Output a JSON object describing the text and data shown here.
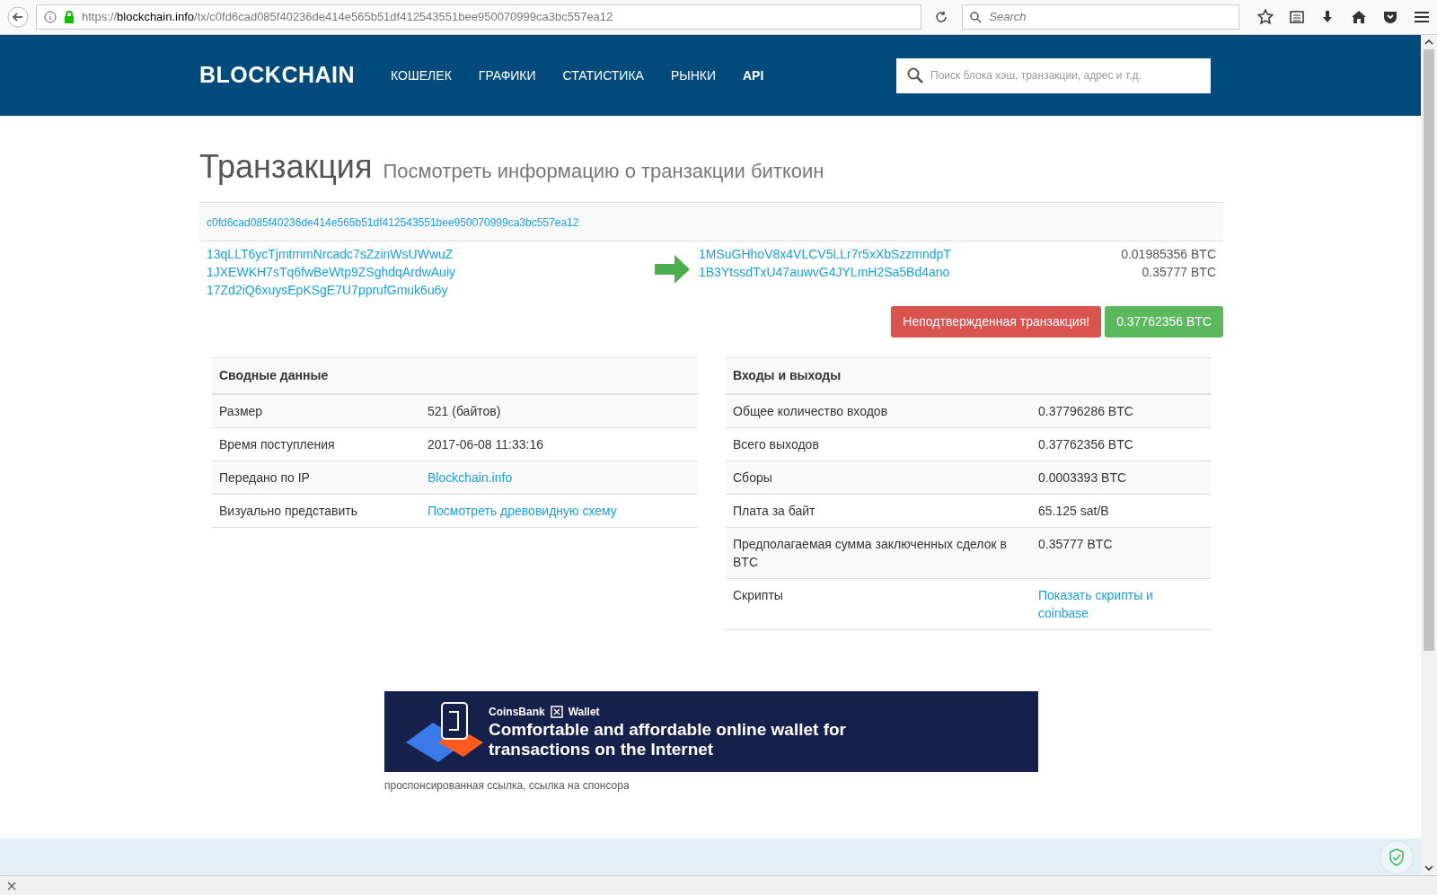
{
  "browser": {
    "url_scheme": "https://",
    "url_host": "blockchain.info",
    "url_path": "/tx/c0fd6cad085f40236de414e565b51df412543551bee950070999ca3bc557ea12",
    "search_placeholder": "Search"
  },
  "header": {
    "logo": "BLOCKCHAIN",
    "nav": [
      {
        "label": "КОШЕЛЕК",
        "bold": false
      },
      {
        "label": "ГРАФИКИ",
        "bold": false
      },
      {
        "label": "СТАТИСТИКА",
        "bold": false
      },
      {
        "label": "РЫНКИ",
        "bold": false
      },
      {
        "label": "API",
        "bold": true
      }
    ],
    "search_placeholder": "Поиск блока хэш, транзакции, адрес и т.д."
  },
  "title": "Транзакция",
  "subtitle": "Посмотреть информацию о транзакции биткоин",
  "tx_hash": "c0fd6cad085f40236de414e565b51df412543551bee950070999ca3bc557ea12",
  "inputs": [
    "13qLLT6ycTjmtmmNrcadc7sZzinWsUWwuZ",
    "1JXEWKH7sTq6fwBeWtp9ZSghdqArdwAuiy",
    "17Zd2iQ6xuysEpKSgE7U7pprufGmuk6u6y"
  ],
  "outputs": [
    {
      "address": "1MSuGHhoV8x4VLCV5LLr7r5xXbSzzmndpT",
      "amount": "0.01985356 BTC"
    },
    {
      "address": "1B3YtssdTxU47auwvG4JYLmH2Sa5Bd4ano",
      "amount": "0.35777 BTC"
    }
  ],
  "status_badge": "Неподтвержденная транзакция!",
  "total_badge": "0.37762356 BTC",
  "summary": {
    "heading": "Сводные данные",
    "rows": [
      {
        "label": "Размер",
        "value": "521 (байтов)",
        "kind": "text"
      },
      {
        "label": "Время поступления",
        "value": "2017-06-08 11:33:16",
        "kind": "text"
      },
      {
        "label": "Передано по IP",
        "value": "Blockchain.info",
        "kind": "link"
      },
      {
        "label": "Визуально представить",
        "value": "Посмотреть древовидную схему",
        "kind": "link"
      }
    ]
  },
  "inputs_outputs": {
    "heading": "Входы и выходы",
    "rows": [
      {
        "label": "Общее количество входов",
        "value": "0.37796286 BTC",
        "kind": "text"
      },
      {
        "label": "Всего выходов",
        "value": "0.37762356 BTC",
        "kind": "text"
      },
      {
        "label": "Сборы",
        "value": "0.0003393 BTC",
        "kind": "text"
      },
      {
        "label": "Плата за байт",
        "value": "65.125 sat/B",
        "kind": "text"
      },
      {
        "label": "Предполагаемая сумма заключенных сделок в BTC",
        "value": "0.35777 BTC",
        "kind": "text"
      },
      {
        "label": "Скрипты",
        "value": "Показать скрипты и coinbase",
        "kind": "link"
      }
    ]
  },
  "ad": {
    "brand": "CoinsBank",
    "product": "Wallet",
    "headline": [
      "Comfortable and affordable online wallet for",
      "transactions on the Internet"
    ],
    "caption": "проспонсированная ссылка, ссылка на спонсора"
  }
}
